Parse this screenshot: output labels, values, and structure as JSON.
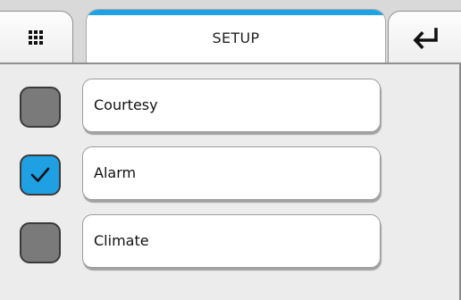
{
  "header": {
    "title": "SETUP",
    "accent_color": "#1fa3e4",
    "left_button": {
      "icon": "grid-menu-icon"
    },
    "right_button": {
      "icon": "enter-return-icon"
    }
  },
  "items": [
    {
      "label": "Courtesy",
      "checked": false
    },
    {
      "label": "Alarm",
      "checked": true
    },
    {
      "label": "Climate",
      "checked": false
    }
  ],
  "colors": {
    "checked": "#1ea0e2",
    "unchecked": "#7a7a7a"
  }
}
